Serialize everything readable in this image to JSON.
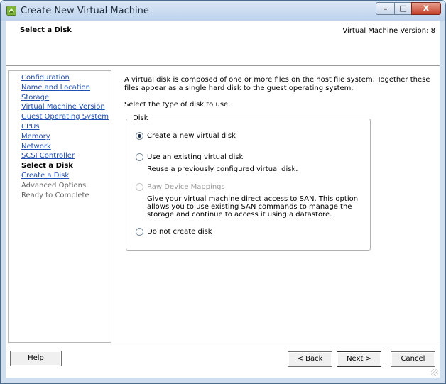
{
  "window": {
    "title": "Create New Virtual Machine",
    "controls": {
      "minimize": "–",
      "maximize": "□",
      "close": "x"
    }
  },
  "header": {
    "title": "Select a Disk",
    "version": "Virtual Machine Version: 8"
  },
  "sidebar": {
    "items": [
      {
        "label": "Configuration",
        "state": "link"
      },
      {
        "label": "Name and Location",
        "state": "link"
      },
      {
        "label": "Storage",
        "state": "link"
      },
      {
        "label": "Virtual Machine Version",
        "state": "link"
      },
      {
        "label": "Guest Operating System",
        "state": "link"
      },
      {
        "label": "CPUs",
        "state": "link"
      },
      {
        "label": "Memory",
        "state": "link"
      },
      {
        "label": "Network",
        "state": "link"
      },
      {
        "label": "SCSI Controller",
        "state": "link"
      },
      {
        "label": "Select a Disk",
        "state": "current"
      },
      {
        "label": "Create a Disk",
        "state": "link"
      },
      {
        "label": "Advanced Options",
        "state": "disabled"
      },
      {
        "label": "Ready to Complete",
        "state": "disabled"
      }
    ]
  },
  "main": {
    "description": "A virtual disk is composed of one or more files on the host file system. Together these files appear as a single hard disk to the guest operating system.",
    "prompt": "Select the type of disk to use.",
    "group_label": "Disk",
    "options": [
      {
        "label": "Create a new virtual disk",
        "checked": true,
        "enabled": true,
        "description": ""
      },
      {
        "label": "Use an existing virtual disk",
        "checked": false,
        "enabled": true,
        "description": "Reuse a previously configured virtual disk."
      },
      {
        "label": "Raw Device Mappings",
        "checked": false,
        "enabled": false,
        "description": "Give your virtual machine direct access to SAN. This option allows you to use existing SAN commands to manage the storage and continue to access it using a datastore."
      },
      {
        "label": "Do not create disk",
        "checked": false,
        "enabled": true,
        "description": ""
      }
    ]
  },
  "footer": {
    "help": "Help",
    "back": "< Back",
    "next": "Next >",
    "cancel": "Cancel"
  }
}
